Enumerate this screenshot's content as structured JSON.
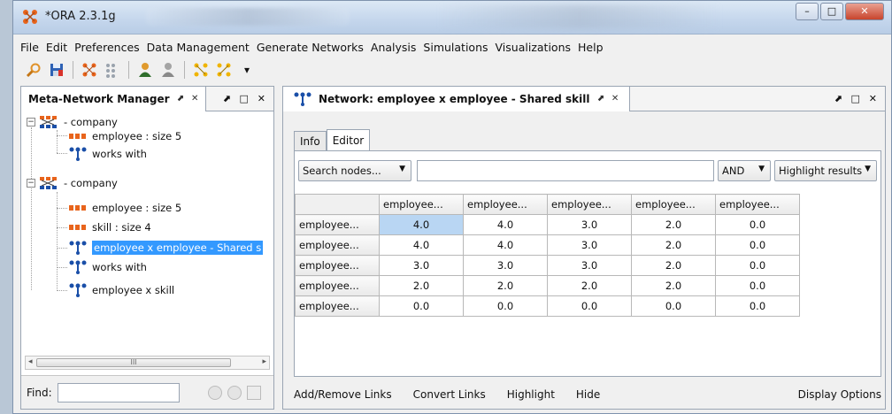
{
  "window": {
    "title": "*ORA 2.3.1g",
    "controls": {
      "minimize": "–",
      "maximize": "□",
      "close": "✕"
    }
  },
  "menu": [
    "File",
    "Edit",
    "Preferences",
    "Data Management",
    "Generate Networks",
    "Analysis",
    "Simulations",
    "Visualizations",
    "Help"
  ],
  "toolbar": {
    "icons": [
      "search-icon",
      "save-icon",
      "network-icon",
      "grid-icon",
      "user-icon",
      "user-gray-icon",
      "network-icon",
      "network-icon",
      "dropdown-arrow-icon"
    ],
    "dropdown_label": "▾"
  },
  "left_panel": {
    "tab_label": "Meta-Network Manager",
    "tab_pin": "⬈",
    "tab_close": "✕",
    "panel_controls": "⬈ □ ✕",
    "tree": [
      {
        "label": "- company",
        "level": 0,
        "type": "metanetwork",
        "expander": "−"
      },
      {
        "label": "employee : size 5",
        "level": 1,
        "type": "nodeset"
      },
      {
        "label": "works with",
        "level": 1,
        "type": "network"
      },
      {
        "label": "- company",
        "level": 0,
        "type": "metanetwork",
        "expander": "−"
      },
      {
        "label": "employee : size 5",
        "level": 1,
        "type": "nodeset"
      },
      {
        "label": "skill : size 4",
        "level": 1,
        "type": "nodeset"
      },
      {
        "label": "employee x employee - Shared s",
        "level": 1,
        "type": "network",
        "selected": true
      },
      {
        "label": "works with",
        "level": 1,
        "type": "network"
      },
      {
        "label": "employee x skill",
        "level": 1,
        "type": "network"
      }
    ],
    "scroll_grip": "III",
    "find_label": "Find:",
    "find_value": ""
  },
  "right_panel": {
    "tab_label": "Network: employee x employee - Shared skill",
    "tab_pin": "⬈",
    "tab_close": "✕",
    "panel_controls": "⬈ □ ✕",
    "sub_tabs": [
      "Info",
      "Editor"
    ],
    "active_sub_tab": "Editor",
    "search_nodes": "Search nodes...",
    "search_value": "",
    "and_combo": "AND",
    "highlight_combo": "Highlight results",
    "matrix": {
      "column_headers": [
        "employee...",
        "employee...",
        "employee...",
        "employee...",
        "employee..."
      ],
      "row_headers": [
        "employee...",
        "employee...",
        "employee...",
        "employee...",
        "employee..."
      ],
      "cells": [
        [
          "4.0",
          "4.0",
          "3.0",
          "2.0",
          "0.0"
        ],
        [
          "4.0",
          "4.0",
          "3.0",
          "2.0",
          "0.0"
        ],
        [
          "3.0",
          "3.0",
          "3.0",
          "2.0",
          "0.0"
        ],
        [
          "2.0",
          "2.0",
          "2.0",
          "2.0",
          "0.0"
        ],
        [
          "0.0",
          "0.0",
          "0.0",
          "0.0",
          "0.0"
        ]
      ],
      "selected_cell": [
        0,
        0
      ]
    },
    "bottom_actions": [
      "Add/Remove Links",
      "Convert Links",
      "Highlight",
      "Hide"
    ],
    "display_options": "Display Options"
  },
  "colors": {
    "selection": "#3399ff",
    "cell_highlight": "#b9d6f3",
    "nodeset_icon": "#e8641c",
    "network_icon": "#1a4fa8"
  }
}
